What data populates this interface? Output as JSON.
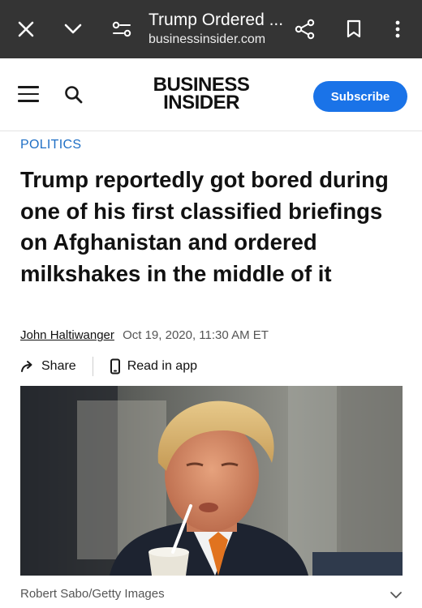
{
  "browser": {
    "title": "Trump Ordered ...",
    "domain": "businessinsider.com"
  },
  "header": {
    "logo_line1": "BUSINESS",
    "logo_line2": "INSIDER",
    "subscribe_label": "Subscribe"
  },
  "article": {
    "category": "POLITICS",
    "headline": "Trump reportedly got bored during one of his first classified briefings on Afghanistan and ordered milkshakes in the middle of it",
    "author": "John Haltiwanger",
    "date": "Oct 19, 2020, 11:30 AM ET",
    "share_label": "Share",
    "read_in_app_label": "Read in app",
    "image_caption": "Robert Sabo/Getty Images"
  },
  "colors": {
    "browser_bar": "#343434",
    "accent": "#1a73e8",
    "category": "#1f6fc5"
  }
}
